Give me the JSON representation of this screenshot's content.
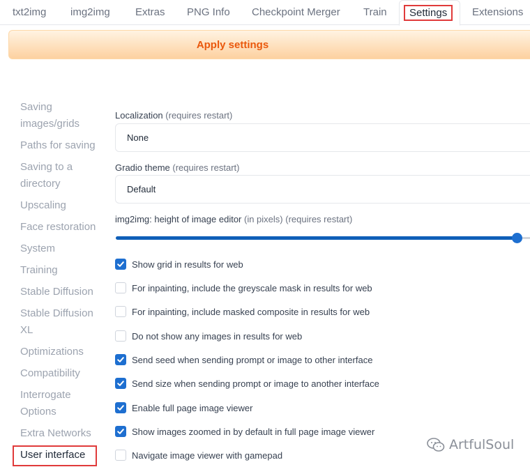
{
  "tabs": [
    {
      "label": "txt2img"
    },
    {
      "label": "img2img"
    },
    {
      "label": "Extras"
    },
    {
      "label": "PNG Info"
    },
    {
      "label": "Checkpoint Merger"
    },
    {
      "label": "Train"
    },
    {
      "label": "Settings",
      "active": true
    },
    {
      "label": "Extensions"
    }
  ],
  "apply_button": {
    "label": "Apply settings"
  },
  "sidebar": {
    "items": [
      {
        "label": "Saving images/grids"
      },
      {
        "label": "Paths for saving"
      },
      {
        "label": "Saving to a directory"
      },
      {
        "label": "Upscaling"
      },
      {
        "label": "Face restoration"
      },
      {
        "label": "System"
      },
      {
        "label": "Training"
      },
      {
        "label": "Stable Diffusion"
      },
      {
        "label": "Stable Diffusion XL"
      },
      {
        "label": "Optimizations"
      },
      {
        "label": "Compatibility"
      },
      {
        "label": "Interrogate Options"
      },
      {
        "label": "Extra Networks"
      },
      {
        "label": "User interface",
        "active": true
      }
    ]
  },
  "settings": {
    "localization": {
      "label": "Localization",
      "note": "(requires restart)",
      "value": "None"
    },
    "gradio_theme": {
      "label": "Gradio theme",
      "note": "(requires restart)",
      "value": "Default"
    },
    "editor_height": {
      "label": "img2img: height of image editor",
      "note1": "(in pixels)",
      "note2": "(requires restart)",
      "level": 0.97
    },
    "checkboxes": [
      {
        "label": "Show grid in results for web",
        "checked": true
      },
      {
        "label": "For inpainting, include the greyscale mask in results for web",
        "checked": false
      },
      {
        "label": "For inpainting, include masked composite in results for web",
        "checked": false
      },
      {
        "label": "Do not show any images in results for web",
        "checked": false
      },
      {
        "label": "Send seed when sending prompt or image to other interface",
        "checked": true
      },
      {
        "label": "Send size when sending prompt or image to another interface",
        "checked": true
      },
      {
        "label": "Enable full page image viewer",
        "checked": true
      },
      {
        "label": "Show images zoomed in by default in full page image viewer",
        "checked": true
      },
      {
        "label": "Navigate image viewer with gamepad",
        "checked": false
      }
    ]
  },
  "watermark": {
    "text": "ArtfulSoul"
  },
  "colors": {
    "accent": "#1e6fd0",
    "apply_text": "#ea580c",
    "highlight": "#e03a3a"
  }
}
